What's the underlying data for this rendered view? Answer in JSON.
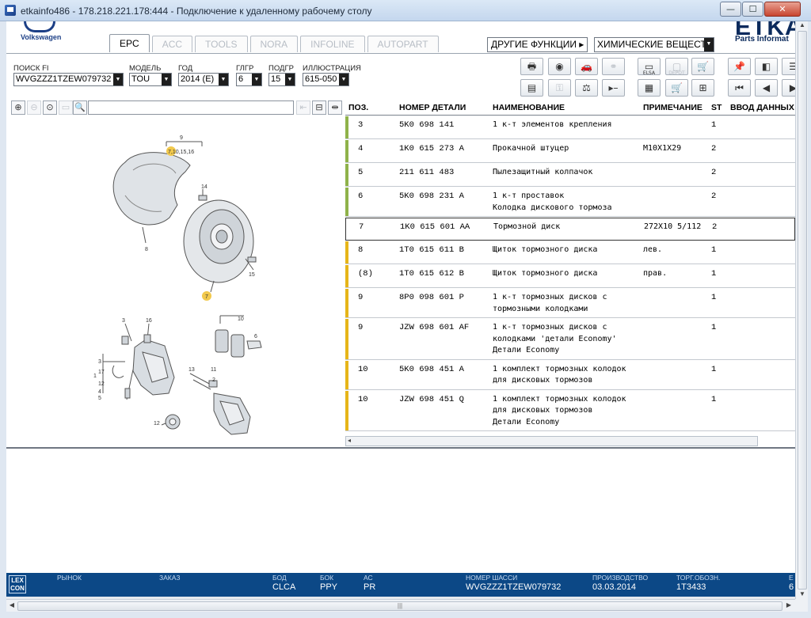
{
  "window": {
    "title": "etkainfo486 - 178.218.221.178:444 - Подключение к удаленному рабочему столу",
    "min_glyph": "—",
    "max_glyph": "☐",
    "close_glyph": "✕"
  },
  "header": {
    "brand": "Volkswagen",
    "etka_logo": "ETKA",
    "etka_sub": "Parts Informat",
    "tabs": [
      {
        "label": "EPC"
      },
      {
        "label": "ACC"
      },
      {
        "label": "TOOLS"
      },
      {
        "label": "NORA"
      },
      {
        "label": "INFOLINE"
      },
      {
        "label": "AUTOPART"
      }
    ],
    "other_functions": "ДРУГИЕ ФУНКЦИИ ▸",
    "other_functions_value": "ХИМИЧЕСКИЕ ВЕЩЕСТ"
  },
  "fields": {
    "search_label": "ПОИСК FI",
    "search_value": "WVGZZZ1TZEW079732",
    "model_label": "МОДЕЛЬ",
    "model_value": "TOU",
    "year_label": "ГОД",
    "year_value": "2014 (E)",
    "group_label": "ГЛГР",
    "group_value": "6",
    "subgroup_label": "ПОДГР",
    "subgroup_value": "15",
    "illustration_label": "ИЛЛЮСТРАЦИЯ",
    "illustration_value": "615-050"
  },
  "toolbar_icons": [
    "printer-icon",
    "disc-icon",
    "car-icon",
    "link-icon",
    "elsa-icon",
    "depot-icon",
    "cart-icon",
    "pin-icon",
    "list-left-icon",
    "list-icon",
    "invoice-icon",
    "key-icon",
    "scale-icon",
    "arrow-dash-icon",
    "notes-icon",
    "cart-add-icon",
    "first-icon",
    "prev-icon",
    "next-icon"
  ],
  "toolbar_labels": {
    "elsa": "ELSA",
    "depot": "DEPOT"
  },
  "parts_table": {
    "headers": {
      "pos": "ПОЗ.",
      "part": "НОМЕР ДЕТАЛИ",
      "name": "НАИМЕНОВАНИЕ",
      "note": "ПРИМЕЧАНИЕ",
      "st": "ST",
      "input": "ВВОД ДАННЫХ"
    },
    "rows": [
      {
        "pos": "3",
        "part": "5K0 698 141",
        "name": [
          "1 к-т элементов крепления"
        ],
        "note": "",
        "st": "1"
      },
      {
        "pos": "4",
        "part": "1K0 615 273 A",
        "name": [
          "Прокачной штуцер"
        ],
        "note": "M10X1X29",
        "st": "2"
      },
      {
        "pos": "5",
        "part": "211 611 483",
        "name": [
          "Пылезащитный колпачок"
        ],
        "note": "",
        "st": "2"
      },
      {
        "pos": "6",
        "part": "5K0 698 231 A",
        "name": [
          "1 к-т проставок",
          "Колодка дискового тормоза"
        ],
        "note": "",
        "st": "2"
      },
      {
        "pos": "7",
        "part": "1K0 615 601 AA",
        "name": [
          "Тормозной диск"
        ],
        "note": "272X10  5/112",
        "st": "2"
      },
      {
        "pos": "8",
        "part": "1T0 615 611 B",
        "name": [
          "Щиток тормозного диска"
        ],
        "note": "лев.",
        "st": "1"
      },
      {
        "pos": "(8)",
        "part": "1T0 615 612 B",
        "name": [
          "Щиток тормозного диска"
        ],
        "note": "прав.",
        "st": "1"
      },
      {
        "pos": "9",
        "part": "8P0 098 601 P",
        "name": [
          "1 к-т тормозных дисков с",
          "тормозными колодками"
        ],
        "note": "",
        "st": "1"
      },
      {
        "pos": "9",
        "part": "JZW 698 601 AF",
        "name": [
          "1 к-т тормозных дисков с",
          "колодками   'детали Economy'",
          "Детали Economy"
        ],
        "note": "",
        "st": "1"
      },
      {
        "pos": "10",
        "part": "5K0 698 451 A",
        "name": [
          "1 комплект тормозных колодок",
          "для дисковых тормозов"
        ],
        "note": "",
        "st": "1"
      },
      {
        "pos": "10",
        "part": "JZW 698 451 Q",
        "name": [
          "1 комплект тормозных колодок",
          "для дисковых тормозов",
          "Детали Economy"
        ],
        "note": "",
        "st": "1"
      }
    ],
    "selected_index": 4
  },
  "illustration": {
    "callouts": [
      "9",
      "7,10,15,16",
      "14",
      "8",
      "15",
      "7",
      "3",
      "16",
      "10",
      "6",
      "1",
      "3",
      "17",
      "12",
      "4",
      "5",
      "13",
      "11",
      "2",
      "12"
    ]
  },
  "status_bar": {
    "lexcom_top": "LEX",
    "lexcom_bottom": "CON",
    "market_label": "РЫНОК",
    "order_label": "ЗАКАЗ",
    "bod_label": "БОД",
    "bod_value": "CLCA",
    "bok_label": "БОК",
    "bok_value": "PPY",
    "ac_label": "АС",
    "ac_value": "PR",
    "chassis_label": "НОМЕР ШАССИ",
    "chassis_value": "WVGZZZ1TZEW079732",
    "prod_label": "ПРОИЗВОДСТВО",
    "prod_value": "03.03.2014",
    "trade_label": "ТОРГ.ОБОЗН.",
    "trade_value": "1T3433",
    "extra_label": "E",
    "extra_value": "6"
  },
  "colors": {
    "status_bg": "#0c4886",
    "row_bar_green": "#8fb24a",
    "row_bar_yellow": "#e6b519",
    "callout_yellow": "#f2c94c"
  }
}
